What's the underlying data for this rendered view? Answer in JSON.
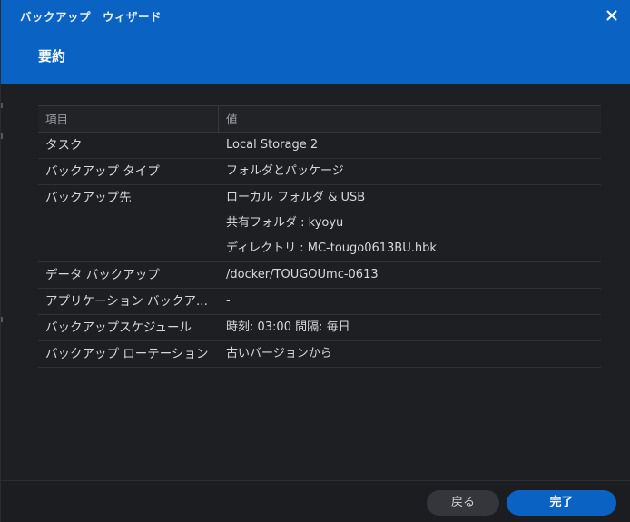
{
  "window": {
    "title": "バックアップ　ウィザード"
  },
  "step": {
    "title": "要約"
  },
  "table": {
    "headers": [
      "項目",
      "値"
    ],
    "rows": [
      {
        "label": "タスク",
        "values": [
          "Local Storage 2"
        ]
      },
      {
        "label": "バックアップ タイプ",
        "values": [
          "フォルダとパッケージ"
        ]
      },
      {
        "label": "バックアップ先",
        "values": [
          "ローカル フォルダ & USB",
          "共有フォルダ : kyoyu",
          "ディレクトリ : MC-tougo0613BU.hbk"
        ]
      },
      {
        "label": "データ バックアップ",
        "values": [
          "/docker/TOUGOUmc-0613"
        ]
      },
      {
        "label": "アプリケーション バックア...",
        "values": [
          "-"
        ]
      },
      {
        "label": "バックアップスケジュール",
        "values": [
          "時刻: 03:00 間隔: 毎日"
        ]
      },
      {
        "label": "バックアップ ローテーション",
        "values": [
          "古いバージョンから"
        ]
      }
    ]
  },
  "footer": {
    "back_label": "戻る",
    "finish_label": "完了"
  },
  "colors": {
    "accent": "#0a63c2",
    "background": "#1e1f22"
  }
}
